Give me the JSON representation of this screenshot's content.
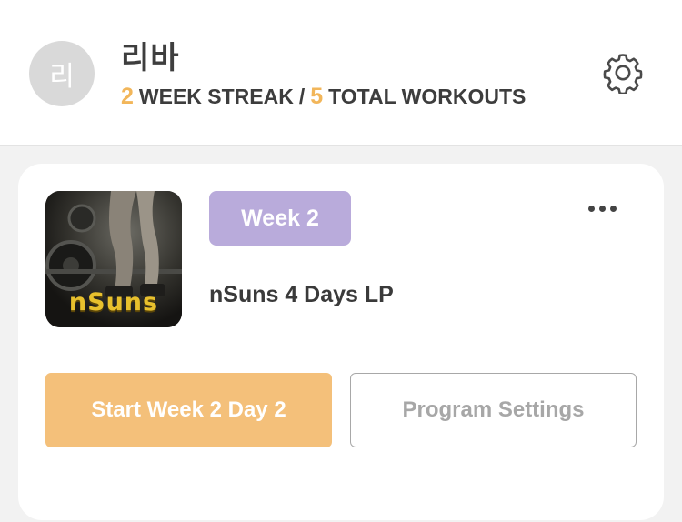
{
  "profile": {
    "avatar_initial": "리",
    "username": "리바",
    "week_streak": "2",
    "week_streak_label": "WEEK STREAK",
    "separator": "/",
    "total_workouts": "5",
    "total_workouts_label": "TOTAL WORKOUTS",
    "settings_icon": "gear-icon"
  },
  "program_card": {
    "thumbnail_text": "nSuns",
    "week_badge": "Week 2",
    "more_icon": "more-horizontal-icon",
    "program_name": "nSuns 4 Days LP",
    "start_button": "Start Week 2 Day 2",
    "settings_button": "Program Settings"
  },
  "colors": {
    "accent_orange": "#f2b65a",
    "start_button_bg": "#f4c07a",
    "week_badge_bg": "#b9abdb"
  }
}
